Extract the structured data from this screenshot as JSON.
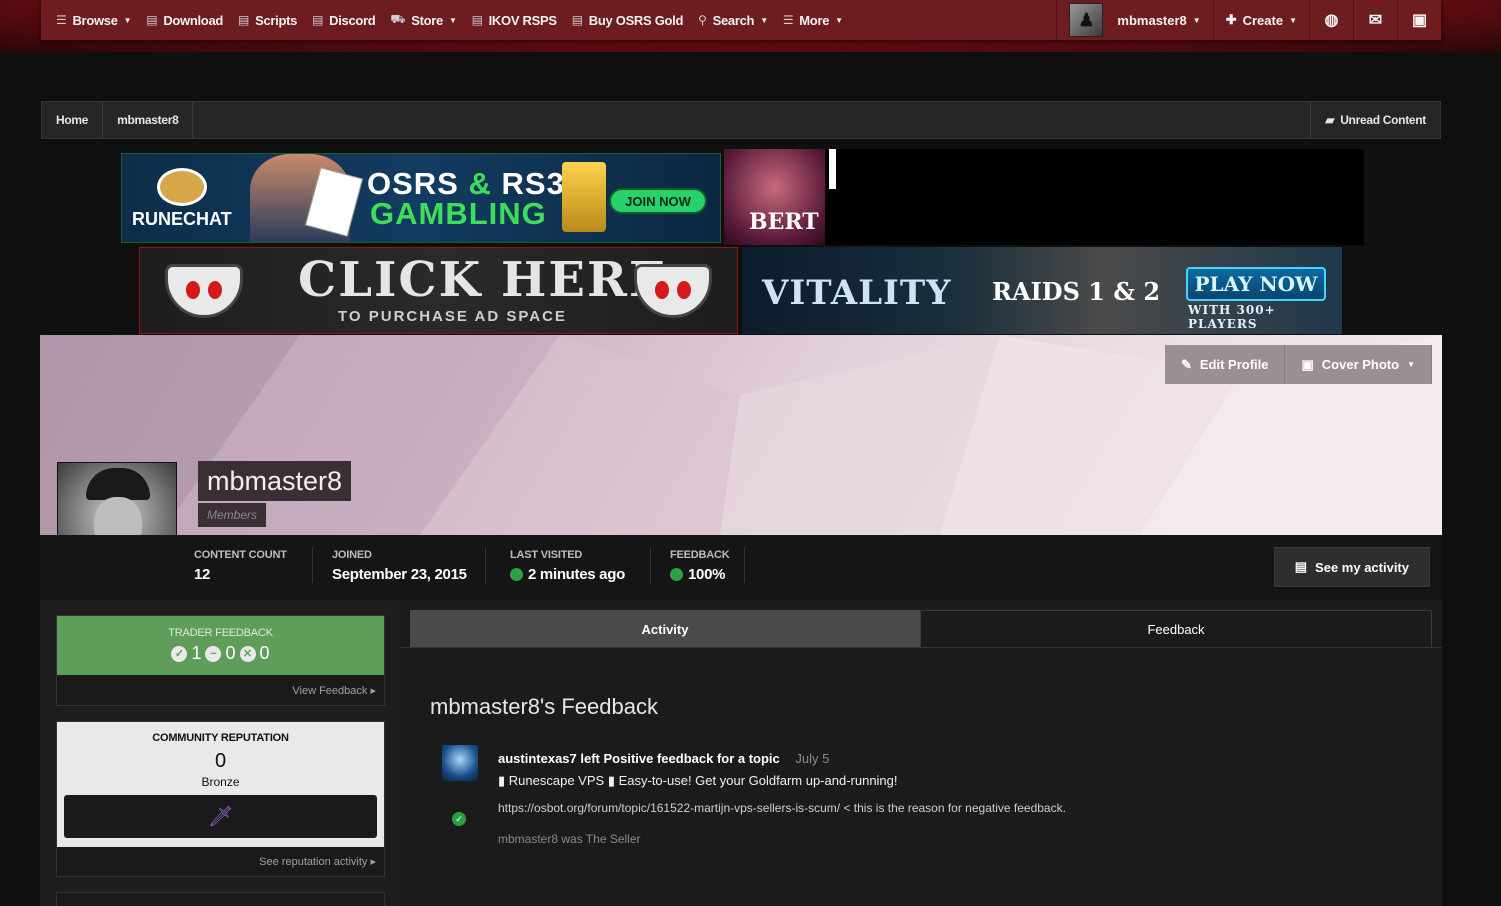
{
  "nav": {
    "items": [
      {
        "icon": "list-icon",
        "label": "Browse",
        "dropdown": true
      },
      {
        "icon": "document-icon",
        "label": "Download",
        "dropdown": false
      },
      {
        "icon": "document-icon",
        "label": "Scripts",
        "dropdown": false
      },
      {
        "icon": "document-icon",
        "label": "Discord",
        "dropdown": false
      },
      {
        "icon": "cart-icon",
        "label": "Store",
        "dropdown": true
      },
      {
        "icon": "document-icon",
        "label": "IKOV RSPS",
        "dropdown": false
      },
      {
        "icon": "document-icon",
        "label": "Buy OSRS Gold",
        "dropdown": false
      },
      {
        "icon": "search-icon",
        "label": "Search",
        "dropdown": true
      },
      {
        "icon": "list-icon",
        "label": "More",
        "dropdown": true
      }
    ],
    "user": "mbmaster8",
    "create_label": "Create"
  },
  "breadcrumb": {
    "items": [
      "Home",
      "mbmaster8"
    ],
    "unread": "Unread Content"
  },
  "ads": {
    "runechat_brand": "RUNECHAT",
    "runechat_line1_a": "OSRS",
    "runechat_line1_b": "&",
    "runechat_line1_c": "RS3",
    "runechat_line2": "GAMBLING",
    "runechat_cta": "JOIN NOW",
    "bert": "BERT",
    "click_here": "CLICK HERE",
    "purchase": "TO PURCHASE AD SPACE",
    "vitality": "VITALITY",
    "raids": "RAIDS 1 & 2",
    "play_now": "PLAY NOW",
    "players": "WITH 300+ PLAYERS"
  },
  "cover": {
    "edit_profile": "Edit Profile",
    "cover_photo": "Cover Photo"
  },
  "profile": {
    "name": "mbmaster8",
    "group": "Members"
  },
  "stats": {
    "content_count_label": "CONTENT COUNT",
    "content_count": "12",
    "joined_label": "JOINED",
    "joined": "September 23, 2015",
    "last_visited_label": "LAST VISITED",
    "last_visited": "2 minutes ago",
    "feedback_label": "FEEDBACK",
    "feedback": "100%",
    "see_activity": "See my activity"
  },
  "sidebar": {
    "trader_feedback_title": "TRADER FEEDBACK",
    "positive": "1",
    "neutral": "0",
    "negative": "0",
    "view_feedback": "View Feedback",
    "reputation_title": "COMMUNITY REPUTATION",
    "reputation_value": "0",
    "reputation_rank": "Bronze",
    "reputation_link": "See reputation activity"
  },
  "main": {
    "tabs": [
      "Activity",
      "Feedback"
    ],
    "active_tab": "Feedback",
    "title": "mbmaster8's Feedback",
    "feedback": {
      "author": "austintexas7",
      "action": "left Positive feedback for a topic",
      "date": "July 5",
      "topic": "Runescape VPS",
      "topic_rest": "Easy-to-use! Get your Goldfarm up-and-running!",
      "comment": "https://osbot.org/forum/topic/161522-martijn-vps-sellers-is-scum/ < this is the reason for negative feedback.",
      "role": "mbmaster8 was The Seller"
    }
  },
  "colors": {
    "nav_red": "#6d1c20",
    "feedback_green": "#5f9e5a",
    "online_green": "#2ea043"
  }
}
